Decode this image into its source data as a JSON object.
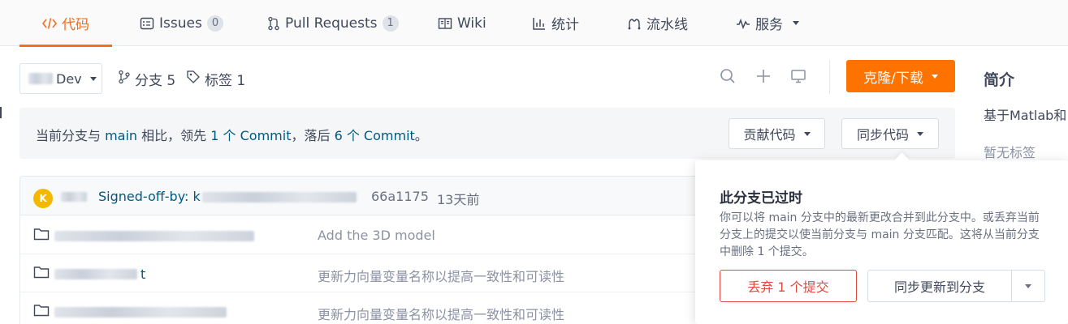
{
  "colors": {
    "accent": "#f36e22",
    "clone_button": "#fe7300",
    "link": "#005980",
    "danger": "#e0483d",
    "avatar": "#f5b800"
  },
  "tabs": [
    {
      "label": "代码",
      "icon": "code-icon",
      "active": true
    },
    {
      "label": "Issues",
      "icon": "issues-icon",
      "count": "0"
    },
    {
      "label": "Pull Requests",
      "icon": "pull-request-icon",
      "count": "1"
    },
    {
      "label": "Wiki",
      "icon": "wiki-icon"
    },
    {
      "label": "统计",
      "icon": "stats-icon"
    },
    {
      "label": "流水线",
      "icon": "pipeline-icon"
    },
    {
      "label": "服务",
      "icon": "service-icon",
      "has_dropdown": true
    }
  ],
  "toolbar": {
    "branch": "Dev",
    "branches": "分支 5",
    "tags": "标签 1",
    "clone_label": "克隆/下载"
  },
  "aside": {
    "title": "简介",
    "description": "基于Matlab和",
    "tags_empty": "暂无标签"
  },
  "compare": {
    "prefix": "当前分支与 ",
    "base": "main",
    "mid1": " 相比，领先 ",
    "ahead": "1 个 Commit",
    "mid2": "，落后 ",
    "behind": "6 个 Commit",
    "suffix": "。",
    "contribute_label": "贡献代码",
    "sync_label": "同步代码"
  },
  "latest_commit": {
    "avatar_letter": "K",
    "message": "Signed-off-by: k",
    "sha": "66a1175",
    "time": "13天前"
  },
  "files": [
    {
      "name_suffix": "",
      "message": "Add the 3D model"
    },
    {
      "name_suffix": "t",
      "message": "更新力向量变量名称以提高一致性和可读性"
    },
    {
      "name_suffix": "",
      "message": "更新力向量变量名称以提高一致性和可读性"
    }
  ],
  "popover": {
    "title": "此分支已过时",
    "description": "你可以将 main 分支中的最新更改合并到此分支中。或丢弃当前分支上的提交以使当前分支与 main 分支匹配。这将从当前分支中删除 1 个提交。",
    "discard_label": "丢弃 1 个提交",
    "sync_label": "同步更新到分支"
  }
}
